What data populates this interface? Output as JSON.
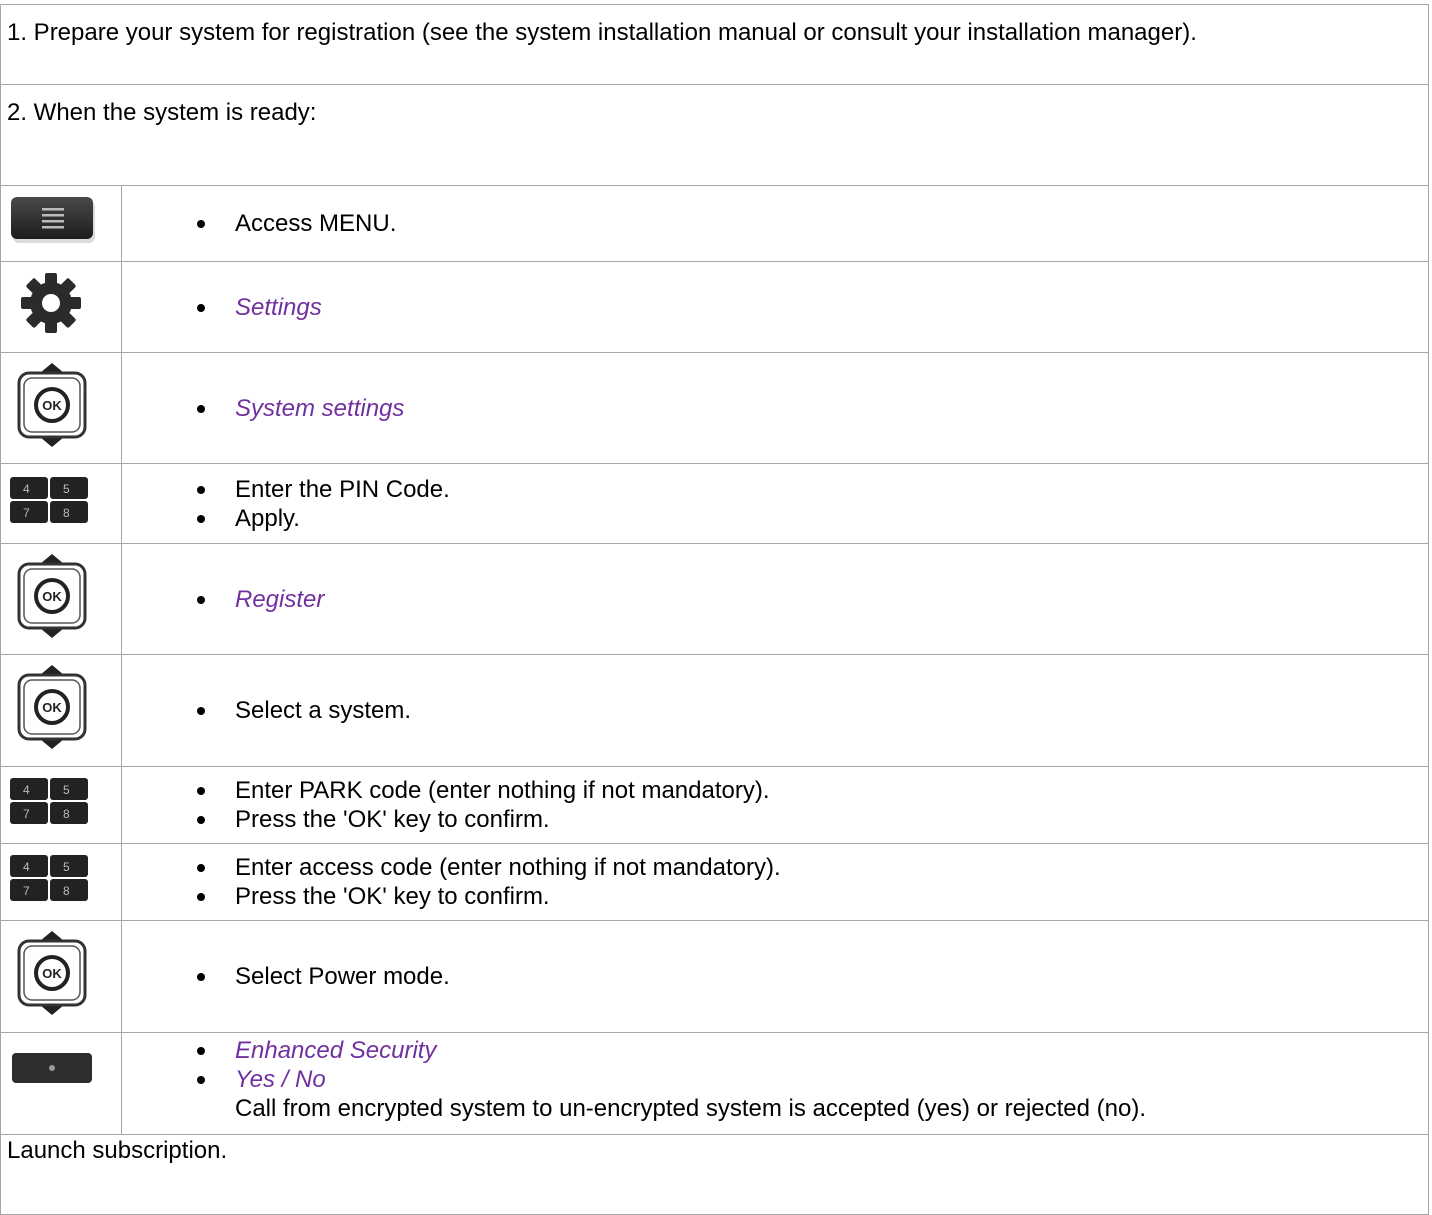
{
  "intro": {
    "step1": "1. Prepare your system for registration (see the system installation manual or consult your installation manager).",
    "step2": "2. When the system is ready:"
  },
  "rows": [
    {
      "icon": "menu-key-icon",
      "items": [
        {
          "text": "Access MENU.",
          "style": "normal"
        }
      ]
    },
    {
      "icon": "gear-icon",
      "items": [
        {
          "text": "Settings",
          "style": "menu"
        }
      ]
    },
    {
      "icon": "ok-navigator-icon",
      "items": [
        {
          "text": "System settings",
          "style": "menu"
        }
      ]
    },
    {
      "icon": "keypad-icon",
      "items": [
        {
          "text": "Enter the PIN Code.",
          "style": "normal"
        },
        {
          "text": "Apply.",
          "style": "normal"
        }
      ]
    },
    {
      "icon": "ok-navigator-icon",
      "items": [
        {
          "text": "Register",
          "style": "menu"
        }
      ]
    },
    {
      "icon": "ok-navigator-icon",
      "items": [
        {
          "text": "Select a system.",
          "style": "normal"
        }
      ]
    },
    {
      "icon": "keypad-icon",
      "items": [
        {
          "text": "Enter PARK code (enter nothing if not mandatory).",
          "style": "normal"
        },
        {
          "text": "Press the 'OK' key to confirm.",
          "style": "normal"
        }
      ]
    },
    {
      "icon": "keypad-icon",
      "items": [
        {
          "text": "Enter access code (enter nothing if not mandatory).",
          "style": "normal"
        },
        {
          "text": "Press the 'OK' key to confirm.",
          "style": "normal"
        }
      ]
    },
    {
      "icon": "ok-navigator-icon",
      "items": [
        {
          "text": "Select Power mode.",
          "style": "normal"
        }
      ]
    },
    {
      "icon": "softkey-icon",
      "items": [
        {
          "text": "Enhanced Security",
          "style": "menu"
        },
        {
          "text": "Yes / No",
          "style": "menu"
        }
      ],
      "note": "Call from encrypted system to un-encrypted system is accepted (yes) or rejected (no)."
    }
  ],
  "footer": "Launch subscription.",
  "colors": {
    "menu_text": "#7030a0",
    "border": "#a6a6a6"
  }
}
